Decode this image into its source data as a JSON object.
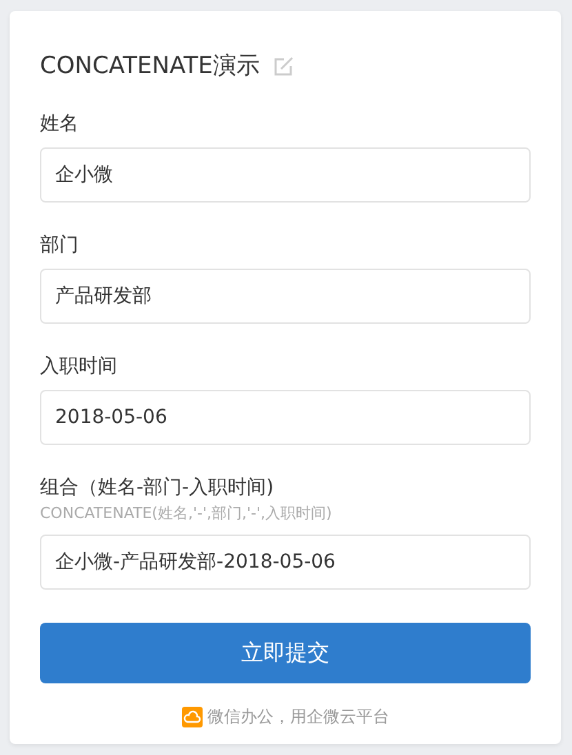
{
  "form": {
    "title": "CONCATENATE演示"
  },
  "fields": [
    {
      "label": "姓名",
      "value": "企小微"
    },
    {
      "label": "部门",
      "value": "产品研发部"
    },
    {
      "label": "入职时间",
      "value": "2018-05-06"
    },
    {
      "label": "组合（姓名-部门-入职时间)",
      "hint": "CONCATENATE(姓名,'-',部门,'-',入职时间)",
      "value": "企小微-产品研发部-2018-05-06"
    }
  ],
  "submit": {
    "label": "立即提交"
  },
  "footer": {
    "text": "微信办公，用企微云平台"
  }
}
